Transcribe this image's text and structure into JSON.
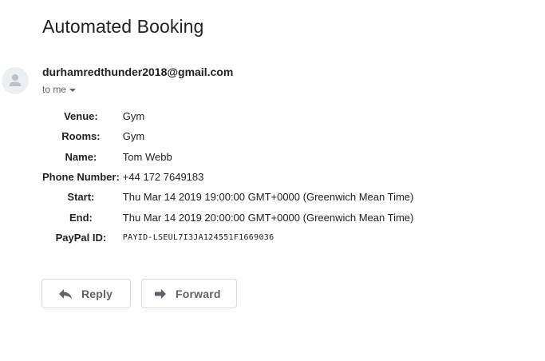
{
  "email": {
    "subject": "Automated Booking",
    "sender": "durhamredthunder2018@gmail.com",
    "recipient_label": "to me",
    "avatar_icon": "person-icon",
    "details": [
      {
        "label": "Venue:",
        "value": "Gym"
      },
      {
        "label": "Rooms:",
        "value": "Gym"
      },
      {
        "label": "Name:",
        "value": "Tom Webb"
      },
      {
        "label": "Phone Number:",
        "value": "+44 172 7649183"
      },
      {
        "label": "Start:",
        "value": "Thu Mar 14 2019 19:00:00 GMT+0000 (Greenwich Mean Time)"
      },
      {
        "label": "End:",
        "value": "Thu Mar 14 2019 20:00:00 GMT+0000 (Greenwich Mean Time)"
      },
      {
        "label": "PayPal ID:",
        "value": "PAYID-LSEUL7I3JA124551F1669036"
      }
    ]
  },
  "actions": {
    "reply_label": "Reply",
    "reply_icon": "reply-arrow-icon",
    "forward_label": "Forward",
    "forward_icon": "forward-arrow-icon"
  },
  "colors": {
    "text": "#222222",
    "secondary_text": "#5f6368",
    "button_border": "#dadce0",
    "avatar_bg": "#eceff1"
  }
}
